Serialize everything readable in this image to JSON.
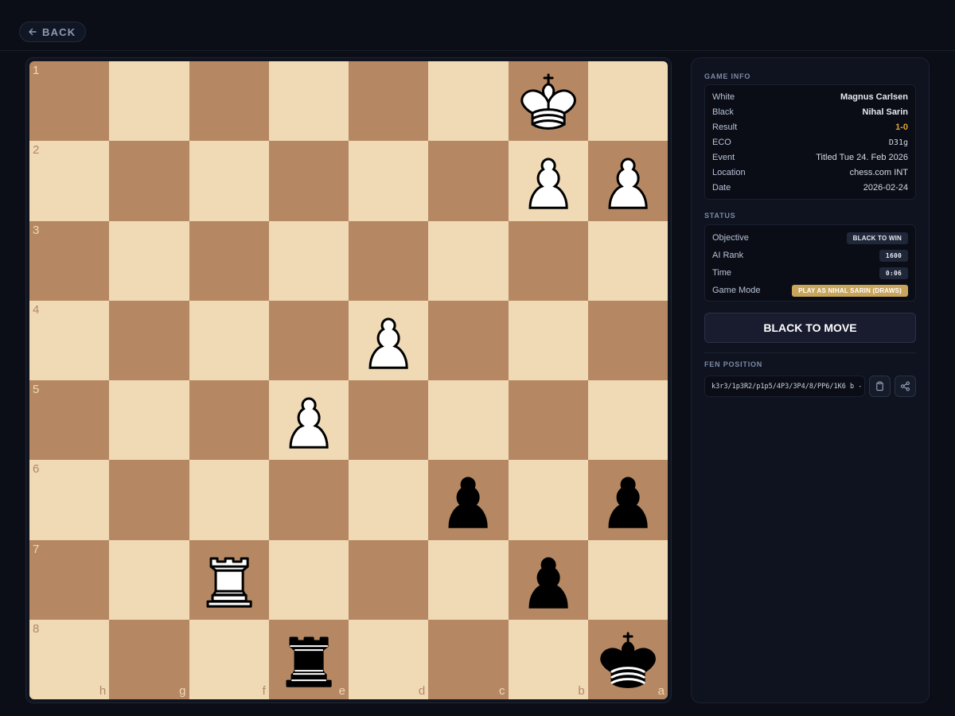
{
  "topbar": {
    "back_label": "BACK"
  },
  "board": {
    "ranks": [
      "1",
      "2",
      "3",
      "4",
      "5",
      "6",
      "7",
      "8"
    ],
    "files": [
      "h",
      "g",
      "f",
      "e",
      "d",
      "c",
      "b",
      "a"
    ],
    "fen": "k3r3/1p3R2/p1p5/4P3/3P4/8/PP6/1K6 b -"
  },
  "game_info": {
    "title": "GAME INFO",
    "rows": [
      {
        "key": "White",
        "value": "Magnus Carlsen"
      },
      {
        "key": "Black",
        "value": "Nihal Sarin"
      },
      {
        "key": "Result",
        "value": "1-0"
      },
      {
        "key": "ECO",
        "value": "D31g"
      },
      {
        "key": "Event",
        "value": "Titled Tue 24. Feb 2026"
      },
      {
        "key": "Location",
        "value": "chess.com INT"
      },
      {
        "key": "Date",
        "value": "2026-02-24"
      }
    ]
  },
  "status": {
    "title": "STATUS",
    "rows": [
      {
        "key": "Objective",
        "value": "BLACK TO WIN"
      },
      {
        "key": "AI Rank",
        "value": "1600"
      },
      {
        "key": "Time",
        "value": "0:06"
      },
      {
        "key": "Game Mode",
        "value": "PLAY AS NIHAL SARIN (DRAWS)"
      }
    ]
  },
  "move_button": {
    "label": "BLACK TO MOVE"
  },
  "fen_section": {
    "title": "FEN POSITION",
    "value": "k3r3/1p3R2/p1p5/4P3/3P4/8/PP6/1K6 b -"
  },
  "colors": {
    "light_square": "#f0d9b5",
    "dark_square": "#b58863",
    "result_accent": "#e0a33d",
    "mode_badge": "#c9a55c"
  },
  "icons": {
    "back": "arrow-left-icon",
    "copy": "clipboard-icon",
    "share": "share-icon"
  }
}
